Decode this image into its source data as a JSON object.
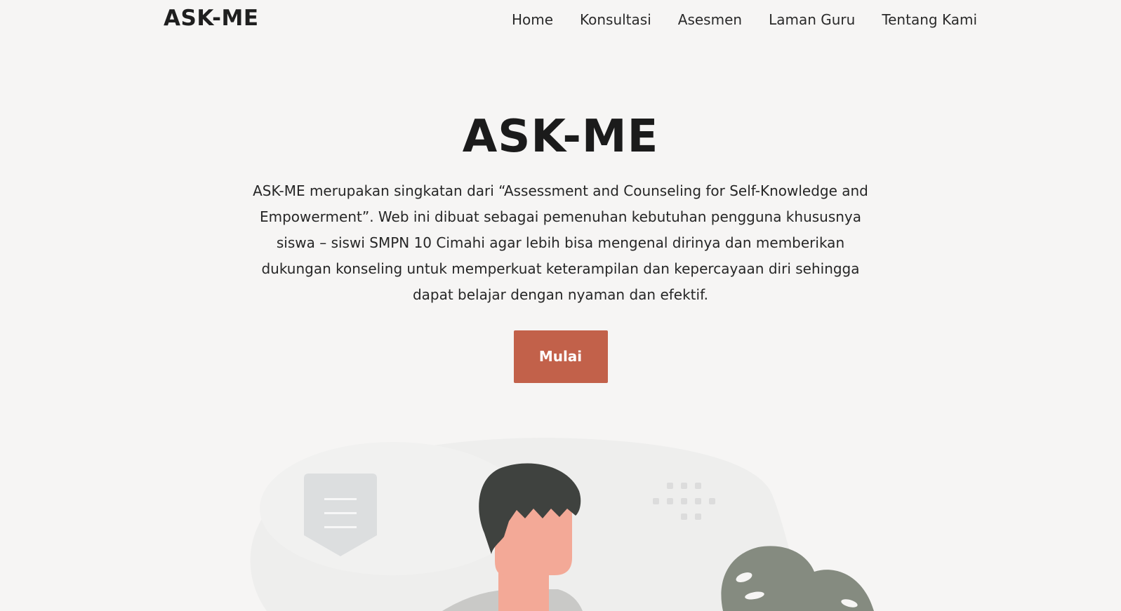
{
  "brand": "ASK-ME",
  "nav": {
    "items": [
      {
        "label": "Home"
      },
      {
        "label": "Konsultasi"
      },
      {
        "label": "Asesmen"
      },
      {
        "label": "Laman Guru"
      },
      {
        "label": "Tentang Kami"
      }
    ]
  },
  "hero": {
    "title": "ASK-ME",
    "description": "ASK-ME merupakan singkatan dari “Assessment and Counseling for Self-Knowledge and Empowerment”. Web ini dibuat sebagai pemenuhan kebutuhan pengguna khususnya siswa – siswi SMPN 10 Cimahi agar lebih bisa mengenal dirinya dan memberikan dukungan konseling untuk memperkuat keterampilan dan kepercayaan diri sehingga dapat belajar dengan nyaman dan efektif.",
    "cta_label": "Mulai"
  },
  "colors": {
    "background": "#f6f5f4",
    "accent": "#c2614a",
    "text": "#1f1f1f"
  },
  "icons": {
    "document": "document-shield-icon",
    "dots": "dot-grid-icon",
    "plant": "plant-leaf-icon"
  }
}
